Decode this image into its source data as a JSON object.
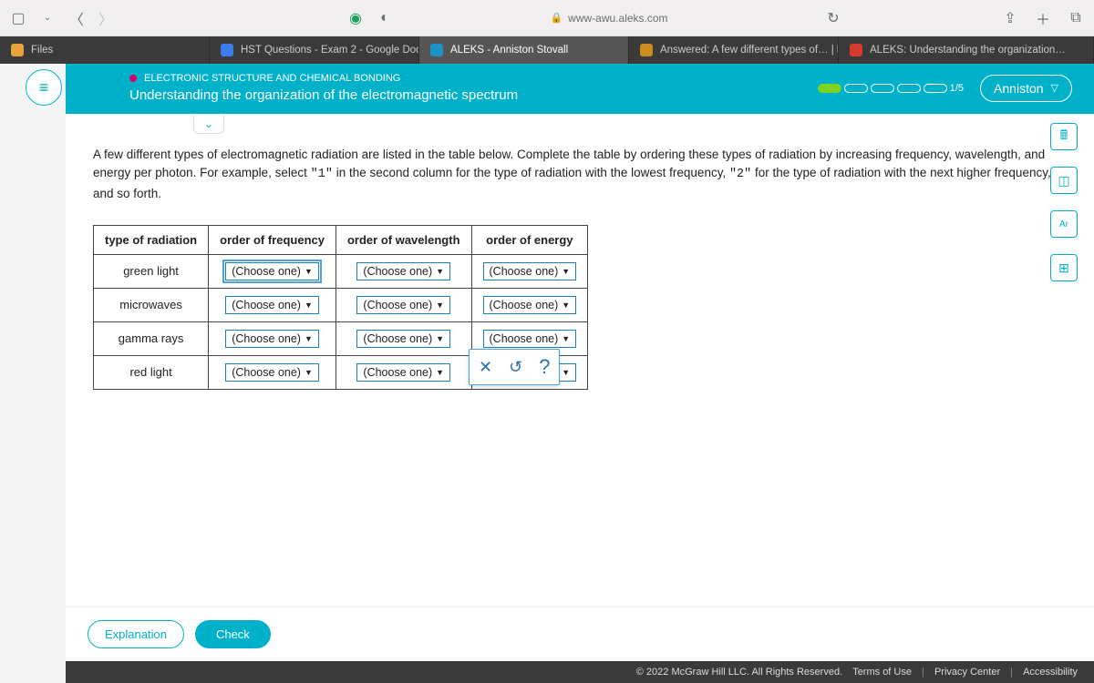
{
  "browser": {
    "url": "www-awu.aleks.com",
    "tabs": [
      {
        "label": "Files",
        "favColor": "#e8a33d"
      },
      {
        "label": "HST Questions - Exam 2 - Google Docs",
        "favColor": "#3b7ded"
      },
      {
        "label": "ALEKS - Anniston Stovall",
        "favColor": "#1b93c9",
        "active": true
      },
      {
        "label": "Answered: A few different types of… | bar…",
        "favColor": "#cc8a1f"
      },
      {
        "label": "ALEKS: Understanding the organization…",
        "favColor": "#d63b2e"
      }
    ]
  },
  "header": {
    "breadcrumb": "ELECTRONIC STRUCTURE AND CHEMICAL BONDING",
    "title": "Understanding the organization of the electromagnetic spectrum",
    "progress_text": "1/5",
    "user": "Anniston"
  },
  "instructions": "A few different types of electromagnetic radiation are listed in the table below. Complete the table by ordering these types of radiation by increasing frequency, wavelength, and energy per photon. For example, select \"1\" in the second column for the type of radiation with the lowest frequency, \"2\" for the type of radiation with the next higher frequency, and so forth.",
  "table": {
    "headers": [
      "type of radiation",
      "order of frequency",
      "order of wavelength",
      "order of energy"
    ],
    "rows": [
      {
        "type": "green light"
      },
      {
        "type": "microwaves"
      },
      {
        "type": "gamma rays"
      },
      {
        "type": "red light"
      }
    ],
    "placeholder": "(Choose one)"
  },
  "buttons": {
    "explanation": "Explanation",
    "check": "Check"
  },
  "footer": {
    "copyright": "© 2022 McGraw Hill LLC. All Rights Reserved.",
    "links": [
      "Terms of Use",
      "Privacy Center",
      "Accessibility"
    ]
  }
}
